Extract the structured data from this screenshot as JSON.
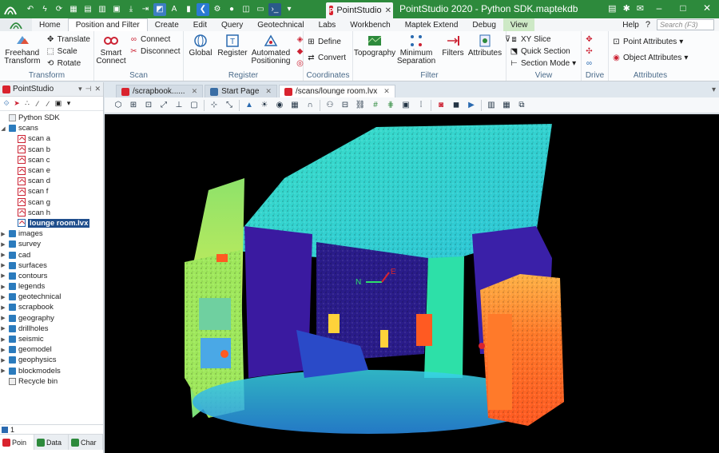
{
  "window": {
    "title": "PointStudio 2020 - Python SDK.maptekdb",
    "doc_tab": "PointStudio",
    "minimize": "–",
    "maximize": "□",
    "close": "✕"
  },
  "ribbon": {
    "tabs": [
      "Home",
      "Position and Filter",
      "Create",
      "Edit",
      "Query",
      "Geotechnical",
      "Labs",
      "Workbench",
      "Maptek Extend",
      "Debug",
      "View"
    ],
    "active_tab": "Position and Filter",
    "help": "Help",
    "search_placeholder": "Search (F3)",
    "groups": {
      "transform": {
        "name": "Transform",
        "freehand": "Freehand Transform",
        "translate": "Translate",
        "scale": "Scale",
        "rotate": "Rotate"
      },
      "scan": {
        "name": "Scan",
        "smart_connect": "Smart Connect",
        "connect": "Connect",
        "disconnect": "Disconnect"
      },
      "register": {
        "name": "Register",
        "global": "Global",
        "register": "Register",
        "automated": "Automated Positioning"
      },
      "coordinates": {
        "name": "Coordinates",
        "define": "Define",
        "convert": "Convert"
      },
      "filter": {
        "name": "Filter",
        "topography": "Topography",
        "min_sep": "Minimum Separation",
        "filters": "Filters",
        "attributes": "Attributes"
      },
      "view": {
        "name": "View",
        "xy_slice": "XY Slice",
        "quick_section": "Quick Section",
        "section_mode": "Section Mode"
      },
      "drive": {
        "name": "Drive"
      },
      "attributes": {
        "name": "Attributes",
        "point_attributes": "Point Attributes",
        "object_attributes": "Object Attributes"
      }
    }
  },
  "left_panel": {
    "title": "PointStudio",
    "root": "Python SDK",
    "scans_folder": "scans",
    "scans": [
      "scan a",
      "scan b",
      "scan c",
      "scan e",
      "scan d",
      "scan f",
      "scan g",
      "scan h"
    ],
    "selected": "lounge room.lvx",
    "folders": [
      "images",
      "survey",
      "cad",
      "surfaces",
      "contours",
      "legends",
      "geotechnical",
      "scrapbook",
      "geography",
      "drillholes",
      "seismic",
      "geomodel",
      "geophysics",
      "blockmodels"
    ],
    "recycle": "Recycle bin",
    "count": "1",
    "bottom_tabs": [
      "Poin",
      "Data",
      "Char"
    ]
  },
  "doc_tabs": [
    "/scrapbook......",
    "Start Page",
    "/scans/lounge room.lvx"
  ],
  "viewport": {
    "axis_n": "N",
    "axis_e": "E"
  }
}
